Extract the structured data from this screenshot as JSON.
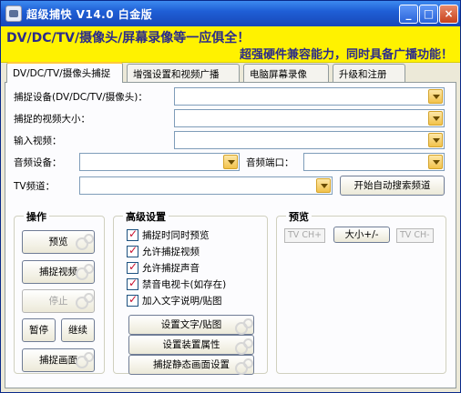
{
  "window": {
    "title": "超级捕快 V14.0 白金版",
    "minimize_glyph": "_",
    "maximize_glyph": "□",
    "close_glyph": "×"
  },
  "banner": {
    "line1": "DV/DC/TV/摄像头/屏幕录像等一应俱全！",
    "line2": "超强硬件兼容能力，同时具备广播功能！"
  },
  "tabs": [
    {
      "label": "DV/DC/TV/摄像头捕捉"
    },
    {
      "label": "增强设置和视频广播"
    },
    {
      "label": "电脑屏幕录像"
    },
    {
      "label": "升级和注册"
    }
  ],
  "form": {
    "device_label": "捕捉设备(DV/DC/TV/摄像头)：",
    "size_label": "捕捉的视频大小：",
    "input_label": "输入视频：",
    "audio_device_label": "音频设备：",
    "audio_port_label": "音频端口：",
    "tv_channel_label": "TV频道：",
    "auto_search_button": "开始自动搜索频道"
  },
  "operation": {
    "title": "操作",
    "preview": "预览",
    "capture_video": "捕捉视频",
    "stop": "停止",
    "pause": "暂停",
    "continue": "继续",
    "capture_frame": "捕捉画面"
  },
  "advanced": {
    "title": "高级设置",
    "checkboxes": [
      {
        "label": "捕捉时同时预览",
        "checked": true
      },
      {
        "label": "允许捕捉视频",
        "checked": true
      },
      {
        "label": "允许捕捉声音",
        "checked": true
      },
      {
        "label": "禁音电视卡(如存在)",
        "checked": true
      },
      {
        "label": "加入文字说明/贴图",
        "checked": true
      }
    ],
    "check_glyph": "✓",
    "set_text_button": "设置文字/贴图",
    "device_props_button": "设置装置属性",
    "still_settings_button": "捕捉静态画面设置"
  },
  "preview_group": {
    "title": "预览",
    "tv_ch_plus": "TV CH+",
    "size_button": "大小+/-",
    "tv_ch_minus": "TV CH-"
  },
  "colors": {
    "title_bar": "#1f5fd6",
    "banner_bg": "#fff200",
    "banner_text": "#2b2b8a",
    "active_tab_accent": "#ffc83c",
    "check_mark": "#c8102e"
  }
}
